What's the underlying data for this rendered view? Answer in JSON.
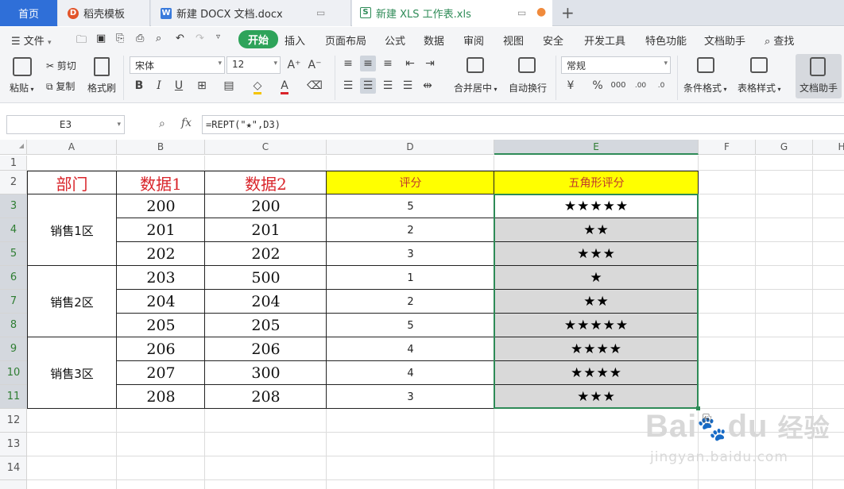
{
  "tabs": {
    "home": "首页",
    "t1": "稻壳模板",
    "t2": "新建 DOCX 文档.docx",
    "t3": "新建 XLS 工作表.xls"
  },
  "menu": {
    "file": "文件",
    "items": [
      "开始",
      "插入",
      "页面布局",
      "公式",
      "数据",
      "审阅",
      "视图",
      "安全",
      "开发工具",
      "特色功能",
      "文档助手"
    ],
    "search": "查找"
  },
  "ribbon": {
    "paste": "粘贴",
    "cut": "剪切",
    "copy": "复制",
    "format_painter": "格式刷",
    "font_name": "宋体",
    "font_size": "12",
    "merge_center": "合并居中",
    "wrap_text": "自动换行",
    "number_format": "常规",
    "percent": "%",
    "cond_format": "条件格式",
    "table_style": "表格样式",
    "doc_helper": "文档助手"
  },
  "formula_bar": {
    "cell_ref": "E3",
    "fx": "fx",
    "formula": "=REPT(\"★\",D3)"
  },
  "columns": [
    "A",
    "B",
    "C",
    "D",
    "E",
    "F",
    "G",
    "H"
  ],
  "rows": [
    "1",
    "2",
    "3",
    "4",
    "5",
    "6",
    "7",
    "8",
    "9",
    "10",
    "11",
    "12",
    "13",
    "14"
  ],
  "table": {
    "headers": [
      "部门",
      "数据1",
      "数据2",
      "评分",
      "五角形评分"
    ],
    "regions": [
      "销售1区",
      "销售2区",
      "销售3区"
    ],
    "data1": [
      "200",
      "201",
      "202",
      "203",
      "204",
      "205",
      "206",
      "207",
      "208"
    ],
    "data2": [
      "200",
      "201",
      "202",
      "500",
      "204",
      "205",
      "206",
      "300",
      "208"
    ],
    "scores": [
      "5",
      "2",
      "3",
      "1",
      "2",
      "5",
      "4",
      "4",
      "3"
    ],
    "stars": [
      "★★★★★",
      "★★",
      "★★★",
      "★",
      "★★",
      "★★★★★",
      "★★★★",
      "★★★★",
      "★★★"
    ]
  },
  "watermark": {
    "brand": "Bai",
    "brand2": "du",
    "cn": "经验",
    "url": "jingyan.baidu.com"
  },
  "colors": {
    "accent_green": "#2e8b57",
    "header_red": "#d9242a",
    "header_fill": "#ffff00",
    "selection_fill": "#d9d9d9"
  }
}
